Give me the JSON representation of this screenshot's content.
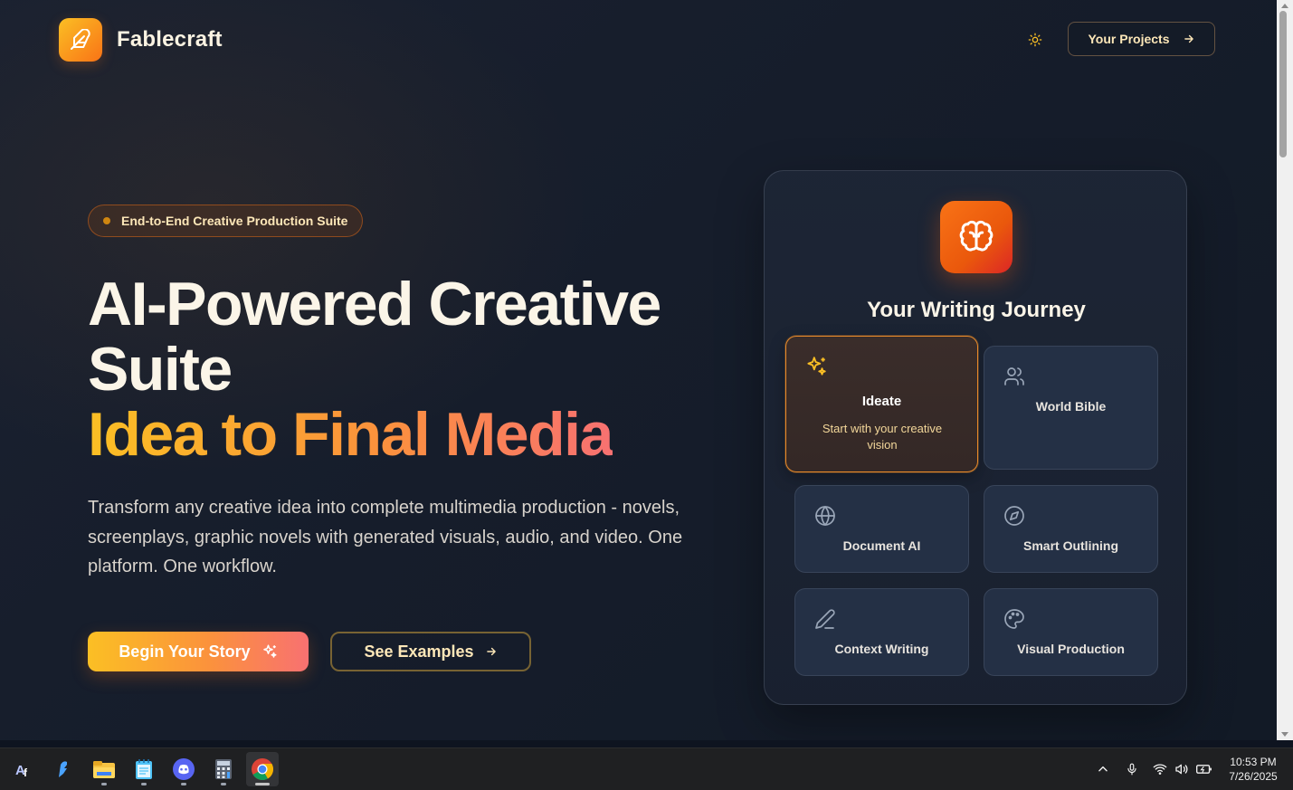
{
  "header": {
    "brand": "Fablecraft",
    "projects_label": "Your Projects"
  },
  "hero": {
    "badge": "End-to-End Creative Production Suite",
    "title": "AI-Powered Creative Suite",
    "accent": "Idea to Final Media",
    "description": "Transform any creative idea into complete multimedia production - novels, screenplays, graphic novels with generated visuals, audio, and video. One platform. One workflow.",
    "primary_cta": "Begin Your Story",
    "secondary_cta": "See Examples"
  },
  "journey": {
    "title": "Your Writing Journey",
    "steps": [
      {
        "label": "Ideate",
        "description": "Start with your creative vision",
        "icon": "sparkles-icon",
        "active": true
      },
      {
        "label": "World Bible",
        "icon": "users-icon"
      },
      {
        "label": "Document AI",
        "icon": "globe-icon"
      },
      {
        "label": "Smart Outlining",
        "icon": "compass-icon"
      },
      {
        "label": "Context Writing",
        "icon": "pen-icon"
      },
      {
        "label": "Visual Production",
        "icon": "palette-icon"
      }
    ]
  },
  "taskbar": {
    "apps": [
      "affinity-app",
      "pen-app",
      "file-explorer",
      "notepad",
      "discord",
      "calculator",
      "chrome"
    ],
    "clock_time": "10:53 PM",
    "clock_date": "7/26/2025"
  },
  "colors": {
    "accent_orange": "#f97316",
    "accent_amber": "#fbbf24",
    "accent_coral": "#f87171",
    "background": "#161d2b"
  }
}
